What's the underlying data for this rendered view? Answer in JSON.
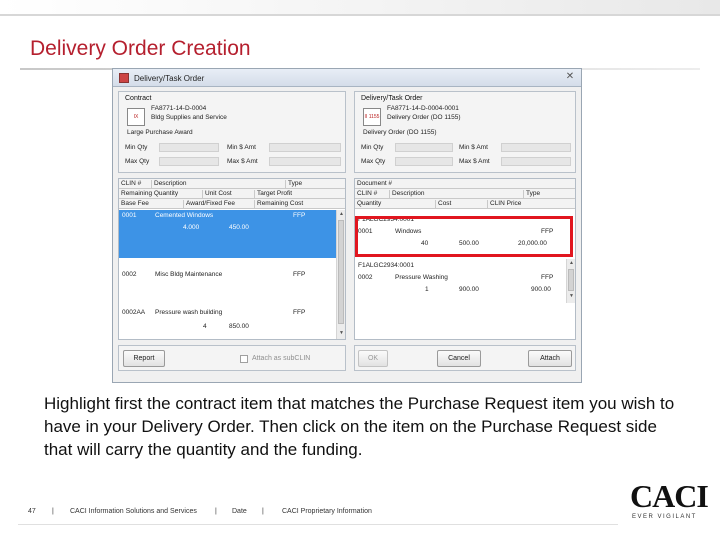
{
  "slide": {
    "title": "Delivery Order Creation",
    "body": "Highlight first the contract item that matches the Purchase Request item you wish to have in your Delivery Order.  Then click on the item on the Purchase Request side that will carry the quantity and the funding.",
    "footer": {
      "page": "47",
      "sep": "|",
      "company": "CACI Information Solutions and Services",
      "date": "Date",
      "classification": "CACI Proprietary Information"
    },
    "logo": {
      "word": "CACI",
      "tagline": "EVER VIGILANT"
    },
    "colors": {
      "title": "#b51f2e",
      "highlight": "#e1161f",
      "selection": "#3d93e6"
    }
  },
  "dialog": {
    "title": "Delivery/Task Order",
    "close_icon": "close-icon",
    "contract": {
      "group_title": "Contract",
      "logo_text": "IX",
      "line1": "FA8771-14-D-0004",
      "line2": "Bldg Supplies and Service",
      "line3": "Large Purchase Award",
      "min_qty_label": "Min Qty",
      "max_qty_label": "Max Qty",
      "min_amt_label": "Min $ Amt",
      "max_amt_label": "Max $ Amt",
      "min_qty": "",
      "max_qty": "",
      "min_amt": "",
      "max_amt": ""
    },
    "delivery": {
      "group_title": "Delivery/Task Order",
      "logo_text": "II 1155",
      "line1": "FA8771-14-D-0004-0001",
      "line2": "Delivery Order (DO 1155)",
      "line3": "Delivery Order (DO 1155)",
      "min_qty_label": "Min Qty",
      "max_qty_label": "Max Qty",
      "min_amt_label": "Min $ Amt",
      "max_amt_label": "Max $ Amt",
      "min_qty": "",
      "max_qty": "",
      "min_amt": "",
      "max_amt": ""
    },
    "contract_grid": {
      "headers_row1": [
        "CLIN #",
        "Description",
        "Type"
      ],
      "headers_row2": [
        "Remaining Quantity",
        "Unit Cost",
        "Target Profit"
      ],
      "headers_row3": [
        "Base Fee",
        "Award/Fixed Fee",
        "Remaining Cost"
      ],
      "items": [
        {
          "clin": "0001",
          "description": "Cemented Windows",
          "type": "FFP",
          "quantity": "4.000",
          "cost": "450.00"
        },
        {
          "clin": "0002",
          "description": "Misc Bldg Maintenance",
          "type": "FFP",
          "quantity": "",
          "cost": ""
        },
        {
          "clin": "0002AA",
          "description": "Pressure wash building",
          "type": "FFP",
          "quantity": "4",
          "cost": "850.00"
        }
      ]
    },
    "request_grid": {
      "headers_row1": [
        "Document #"
      ],
      "headers_row2": [
        "CLIN #",
        "Description",
        "Type"
      ],
      "headers_row3": [
        "Quantity",
        "Cost",
        "CLIN Price"
      ],
      "documents": [
        {
          "doc": "F1ALGC2934:0001",
          "clin": "0001",
          "description": "Windows",
          "type": "FFP",
          "quantity": "40",
          "cost": "500.00",
          "price": "20,000.00"
        },
        {
          "doc": "F1ALGC2934:0001",
          "clin": "0002",
          "description": "Pressure Washing",
          "type": "FFP",
          "quantity": "1",
          "cost": "900.00",
          "price": "900.00"
        }
      ]
    },
    "buttons": {
      "report": "Report",
      "attach_sub": "Attach as subCLIN",
      "ok": "OK",
      "cancel": "Cancel",
      "attach": "Attach"
    }
  }
}
